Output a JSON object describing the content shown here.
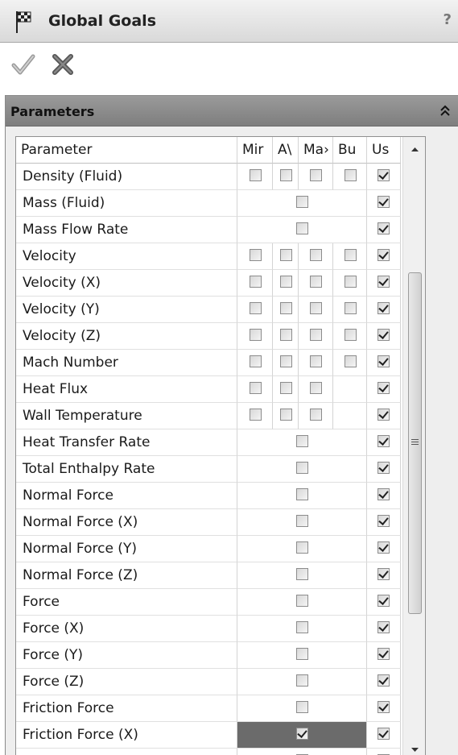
{
  "dialog": {
    "title": "Global Goals",
    "help_label": "?"
  },
  "toolbar": {
    "ok": "ok-checkmark-icon",
    "cancel": "cancel-x-icon"
  },
  "panel": {
    "title": "Parameters",
    "collapse_icon": "double-chevron-up-icon"
  },
  "table": {
    "columns": {
      "param": "Parameter",
      "min": "Mir",
      "avg": "A\\",
      "max": "Ma›",
      "bulk": "Bu",
      "use": "Us"
    },
    "rows": [
      {
        "label": "Density (Fluid)",
        "min": false,
        "avg": false,
        "max": false,
        "bulk": false,
        "use": true
      },
      {
        "label": "Mass (Fluid)",
        "min": null,
        "avg": false,
        "max": null,
        "bulk": null,
        "use": true,
        "center": true
      },
      {
        "label": "Mass Flow Rate",
        "min": null,
        "avg": false,
        "max": null,
        "bulk": null,
        "use": true,
        "center": true
      },
      {
        "label": "Velocity",
        "min": false,
        "avg": false,
        "max": false,
        "bulk": false,
        "use": true
      },
      {
        "label": "Velocity (X)",
        "min": false,
        "avg": false,
        "max": false,
        "bulk": false,
        "use": true
      },
      {
        "label": "Velocity (Y)",
        "min": false,
        "avg": false,
        "max": false,
        "bulk": false,
        "use": true
      },
      {
        "label": "Velocity (Z)",
        "min": false,
        "avg": false,
        "max": false,
        "bulk": false,
        "use": true
      },
      {
        "label": "Mach Number",
        "min": false,
        "avg": false,
        "max": false,
        "bulk": false,
        "use": true
      },
      {
        "label": "Heat Flux",
        "min": false,
        "avg": false,
        "max": false,
        "bulk": null,
        "use": true
      },
      {
        "label": "Wall Temperature",
        "min": false,
        "avg": false,
        "max": false,
        "bulk": null,
        "use": true
      },
      {
        "label": "Heat Transfer Rate",
        "min": null,
        "avg": false,
        "max": null,
        "bulk": null,
        "use": true,
        "center": true
      },
      {
        "label": "Total Enthalpy Rate",
        "min": null,
        "avg": false,
        "max": null,
        "bulk": null,
        "use": true,
        "center": true
      },
      {
        "label": "Normal Force",
        "min": null,
        "avg": false,
        "max": null,
        "bulk": null,
        "use": true,
        "center": true
      },
      {
        "label": "Normal Force (X)",
        "min": null,
        "avg": false,
        "max": null,
        "bulk": null,
        "use": true,
        "center": true
      },
      {
        "label": "Normal Force (Y)",
        "min": null,
        "avg": false,
        "max": null,
        "bulk": null,
        "use": true,
        "center": true
      },
      {
        "label": "Normal Force (Z)",
        "min": null,
        "avg": false,
        "max": null,
        "bulk": null,
        "use": true,
        "center": true
      },
      {
        "label": "Force",
        "min": null,
        "avg": false,
        "max": null,
        "bulk": null,
        "use": true,
        "center": true
      },
      {
        "label": "Force (X)",
        "min": null,
        "avg": false,
        "max": null,
        "bulk": null,
        "use": true,
        "center": true
      },
      {
        "label": "Force (Y)",
        "min": null,
        "avg": false,
        "max": null,
        "bulk": null,
        "use": true,
        "center": true
      },
      {
        "label": "Force (Z)",
        "min": null,
        "avg": false,
        "max": null,
        "bulk": null,
        "use": true,
        "center": true
      },
      {
        "label": "Friction Force",
        "min": null,
        "avg": false,
        "max": null,
        "bulk": null,
        "use": true,
        "center": true
      },
      {
        "label": "Friction Force (X)",
        "min": null,
        "avg": true,
        "max": null,
        "bulk": null,
        "use": true,
        "center": true,
        "selected": true
      },
      {
        "label": "",
        "min": null,
        "avg": false,
        "max": null,
        "bulk": null,
        "use": true,
        "center": true
      }
    ]
  },
  "scrollbar": {
    "up_icon": "scroll-up-arrow-icon",
    "down_icon": "scroll-down-arrow-icon"
  },
  "colors": {
    "titlebar": "#d9d9d9",
    "panel_header": "#8a8a8a",
    "selected_row": "#6b6b6b"
  }
}
